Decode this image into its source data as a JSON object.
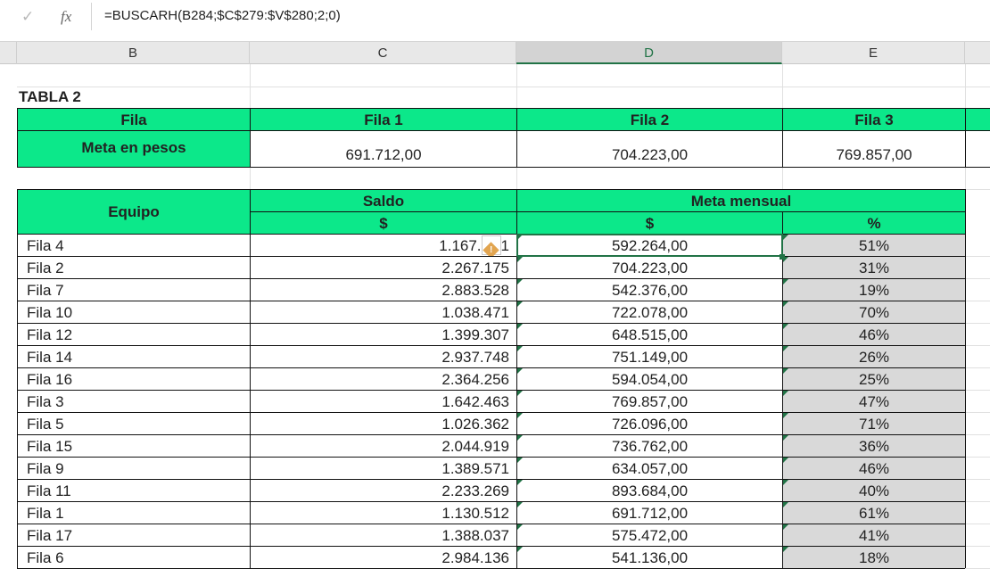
{
  "formula_bar": {
    "check_icon": "checkmark-icon",
    "fx_label": "fx",
    "formula": "=BUSCARH(B284;$C$279:$V$280;2;0)"
  },
  "columns": [
    "B",
    "C",
    "D",
    "E"
  ],
  "selected_column": "D",
  "table2": {
    "title": "TABLA 2",
    "header_label": "Fila",
    "headers": [
      "Fila 1",
      "Fila 2",
      "Fila 3"
    ],
    "meta_label": "Meta en pesos",
    "meta_values": [
      "691.712,00",
      "704.223,00",
      "769.857,00"
    ]
  },
  "main": {
    "equipo": "Equipo",
    "saldo": "Saldo",
    "meta_mensual": "Meta mensual",
    "currency": "$",
    "percent": "%",
    "rows": [
      {
        "fila": "Fila 4",
        "saldo": "1.167.",
        "saldo_tail": "1",
        "meta": "592.264,00",
        "pct": "51%"
      },
      {
        "fila": "Fila 2",
        "saldo": "2.267.175",
        "meta": "704.223,00",
        "pct": "31%"
      },
      {
        "fila": "Fila 7",
        "saldo": "2.883.528",
        "meta": "542.376,00",
        "pct": "19%"
      },
      {
        "fila": "Fila 10",
        "saldo": "1.038.471",
        "meta": "722.078,00",
        "pct": "70%"
      },
      {
        "fila": "Fila 12",
        "saldo": "1.399.307",
        "meta": "648.515,00",
        "pct": "46%"
      },
      {
        "fila": "Fila 14",
        "saldo": "2.937.748",
        "meta": "751.149,00",
        "pct": "26%"
      },
      {
        "fila": "Fila 16",
        "saldo": "2.364.256",
        "meta": "594.054,00",
        "pct": "25%"
      },
      {
        "fila": "Fila 3",
        "saldo": "1.642.463",
        "meta": "769.857,00",
        "pct": "47%"
      },
      {
        "fila": "Fila 5",
        "saldo": "1.026.362",
        "meta": "726.096,00",
        "pct": "71%"
      },
      {
        "fila": "Fila 15",
        "saldo": "2.044.919",
        "meta": "736.762,00",
        "pct": "36%"
      },
      {
        "fila": "Fila 9",
        "saldo": "1.389.571",
        "meta": "634.057,00",
        "pct": "46%"
      },
      {
        "fila": "Fila 11",
        "saldo": "2.233.269",
        "meta": "893.684,00",
        "pct": "40%"
      },
      {
        "fila": "Fila 1",
        "saldo": "1.130.512",
        "meta": "691.712,00",
        "pct": "61%"
      },
      {
        "fila": "Fila 17",
        "saldo": "1.388.037",
        "meta": "575.472,00",
        "pct": "41%"
      },
      {
        "fila": "Fila 6",
        "saldo": "2.984.136",
        "meta": "541.136,00",
        "pct": "18%"
      }
    ]
  },
  "colors": {
    "header_green": "#0ce88a",
    "selection": "#217346",
    "pct_fill": "#d9d9d9"
  }
}
